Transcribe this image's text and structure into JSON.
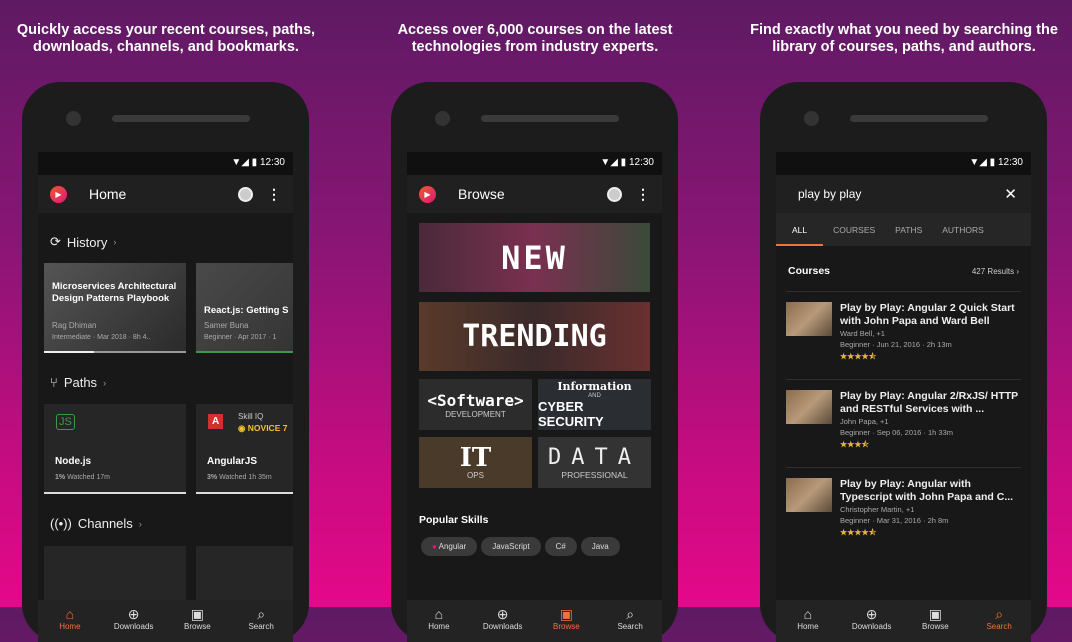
{
  "captions": [
    "Quickly access your recent courses, paths, downloads, channels, and bookmarks.",
    "Access over 6,000 courses on the latest technologies from industry experts.",
    "Find exactly what you need by searching the library of courses, paths, and authors."
  ],
  "status_time": "12:30",
  "home": {
    "title": "Home",
    "history_label": "History",
    "history": [
      {
        "title": "Microservices Architectural Design Patterns Playbook",
        "author": "Rag Dhiman",
        "meta": "Intermediate · Mar 2018 · 8h 4..",
        "progress": 0.35
      },
      {
        "title": "React.js: Getting S",
        "author": "Samer Buna",
        "meta": "Beginner · Apr 2017 · 1",
        "progress": 1.0
      }
    ],
    "paths_label": "Paths",
    "paths": [
      {
        "name": "Node.js",
        "pct": "1%",
        "watched": "Watched 17m",
        "icon": "nodejs-icon"
      },
      {
        "name": "AngularJS",
        "pct": "3%",
        "watched": "Watched 1h 35m",
        "icon": "angular-icon",
        "skill_label": "Skill IQ",
        "skill_level": "NOVICE 7"
      }
    ],
    "channels_label": "Channels"
  },
  "browse": {
    "title": "Browse",
    "tiles": [
      {
        "main": "NEW"
      },
      {
        "main": "TRENDING"
      },
      {
        "main": "<Software>",
        "sub": "DEVELOPMENT"
      },
      {
        "top": "Information",
        "mid": "AND",
        "main": "CYBER SECURITY"
      },
      {
        "main": "IT",
        "sub": "OPS"
      },
      {
        "main": "DATA",
        "sub": "PROFESSIONAL"
      }
    ],
    "skills_label": "Popular Skills",
    "skills": [
      "Angular",
      "JavaScript",
      "C#",
      "Java"
    ]
  },
  "search": {
    "query": "play by play",
    "tabs": [
      "ALL",
      "COURSES",
      "PATHS",
      "AUTHORS"
    ],
    "courses_label": "Courses",
    "results_count": "427 Results",
    "results": [
      {
        "title": "Play by Play: Angular 2 Quick Start with John Papa and Ward Bell",
        "author": "Ward Bell, +1",
        "level": "Beginner",
        "date": "Jun 21, 2016",
        "duration": "2h 13m",
        "stars": "★★★★⯪",
        "rating": 4.5
      },
      {
        "title": "Play by Play: Angular 2/RxJS/ HTTP and RESTful Services with ...",
        "author": "John Papa, +1",
        "level": "Beginner",
        "date": "Sep 06, 2016",
        "duration": "1h 33m",
        "stars": "★★★⯪",
        "rating": 3.5
      },
      {
        "title": "Play by Play: Angular with Typescript with John Papa and C...",
        "author": "Christopher Martin, +1",
        "level": "Beginner",
        "date": "Mar 31, 2016",
        "duration": "2h 8m",
        "stars": "★★★★⯪",
        "rating": 4.5
      }
    ]
  },
  "nav": [
    "Home",
    "Downloads",
    "Browse",
    "Search"
  ],
  "colors": {
    "accent": "#f1733a",
    "background_top": "#5e1a63",
    "background_bottom": "#e5088a"
  }
}
